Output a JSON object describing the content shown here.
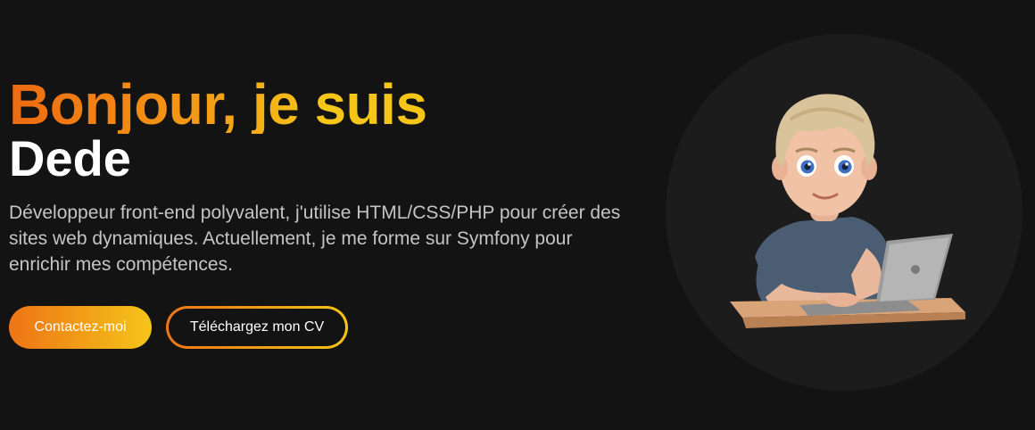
{
  "hero": {
    "greeting": "Bonjour, je suis",
    "name": "Dede",
    "description": "Développeur front-end polyvalent, j'utilise HTML/CSS/PHP pour créer des sites web dynamiques. Actuellement, je me forme sur Symfony pour enrichir mes compétences."
  },
  "buttons": {
    "contact_label": "Contactez-moi",
    "cv_label": "Téléchargez mon CV"
  },
  "colors": {
    "background": "#131313",
    "accent_start": "#ee6a12",
    "accent_end": "#f5c518",
    "text_muted": "#c4c4c4",
    "avatar_circle": "#1c1c1c"
  },
  "illustration": {
    "icon": "developer-avatar-laptop-icon"
  }
}
